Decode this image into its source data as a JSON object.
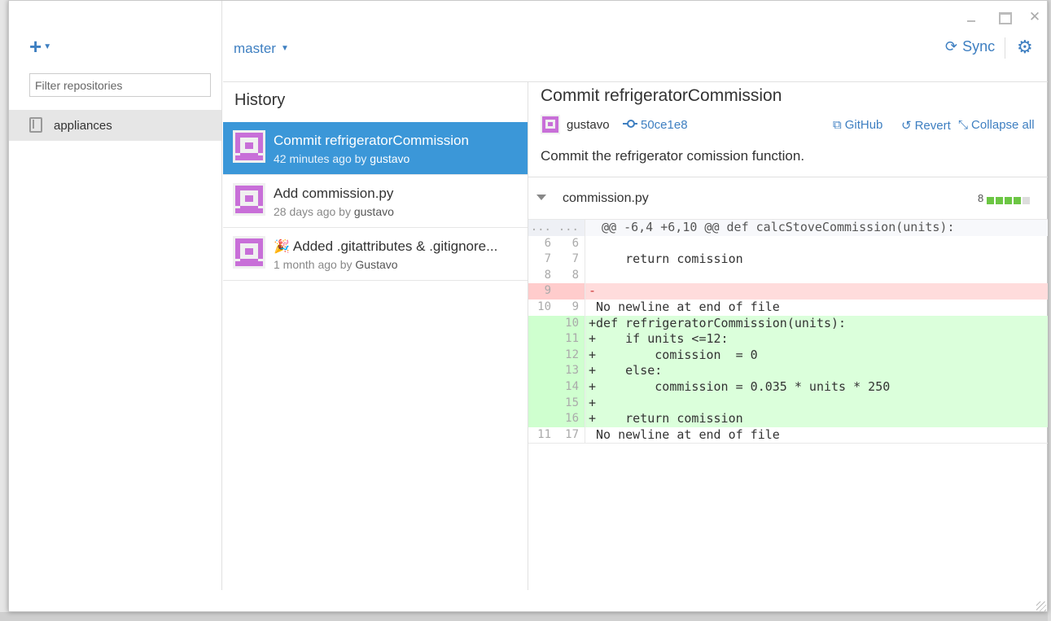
{
  "sidebar": {
    "add_label": "+",
    "filter_placeholder": "Filter repositories",
    "repos": [
      {
        "label": "appliances"
      }
    ]
  },
  "header": {
    "branch": "master",
    "sync_label": "Sync"
  },
  "history": {
    "title": "History",
    "commits": [
      {
        "title": "Commit refrigeratorCommission",
        "time": "42 minutes ago by ",
        "author": "gustavo",
        "selected": true
      },
      {
        "title": "Add commission.py",
        "time": "28 days ago by ",
        "author": "gustavo",
        "selected": false
      },
      {
        "title": "Added .gitattributes & .gitignore...",
        "time": "1 month ago by ",
        "author": "Gustavo",
        "selected": false,
        "emoji": "🎉"
      }
    ]
  },
  "detail": {
    "title": "Commit refrigeratorCommission",
    "author": "gustavo",
    "sha": "50ce1e8",
    "actions": {
      "github": "GitHub",
      "revert": "Revert",
      "collapse": "Collapse all"
    },
    "description": "Commit the refrigerator comission function.",
    "file": {
      "name": "commission.py",
      "changes": "8",
      "additions_blocks": 4,
      "neutral_blocks": 1
    },
    "diff": [
      {
        "type": "hunk",
        "ln1": "...",
        "ln2": "...",
        "code": "@@ -6,4 +6,10 @@ def calcStoveCommission(units):"
      },
      {
        "type": "ctx",
        "ln1": "6",
        "ln2": "6",
        "code": " "
      },
      {
        "type": "ctx",
        "ln1": "7",
        "ln2": "7",
        "code": "     return comission"
      },
      {
        "type": "ctx",
        "ln1": "8",
        "ln2": "8",
        "code": " "
      },
      {
        "type": "del",
        "ln1": "9",
        "ln2": "",
        "code": "-"
      },
      {
        "type": "ctx",
        "ln1": "10",
        "ln2": "9",
        "code": " No newline at end of file"
      },
      {
        "type": "add",
        "ln1": "",
        "ln2": "10",
        "code": "+def refrigeratorCommission(units):"
      },
      {
        "type": "add",
        "ln1": "",
        "ln2": "11",
        "code": "+    if units <=12:"
      },
      {
        "type": "add",
        "ln1": "",
        "ln2": "12",
        "code": "+        comission  = 0"
      },
      {
        "type": "add",
        "ln1": "",
        "ln2": "13",
        "code": "+    else:"
      },
      {
        "type": "add",
        "ln1": "",
        "ln2": "14",
        "code": "+        commission = 0.035 * units * 250"
      },
      {
        "type": "add",
        "ln1": "",
        "ln2": "15",
        "code": "+"
      },
      {
        "type": "add",
        "ln1": "",
        "ln2": "16",
        "code": "+    return comission"
      },
      {
        "type": "ctx",
        "ln1": "11",
        "ln2": "17",
        "code": " No newline at end of file"
      }
    ]
  },
  "colors": {
    "accent": "#3e7fc1",
    "selected": "#3b97d8",
    "avatar": "#c86fd8",
    "add_bg": "#dbffdb",
    "del_bg": "#ffdcdc"
  },
  "icons": [
    "plus-icon",
    "repo-icon",
    "sync-icon",
    "gear-icon",
    "commit-sha-icon",
    "external-link-icon",
    "revert-icon",
    "collapse-icon",
    "chevron-down-icon",
    "party-popper-icon"
  ]
}
